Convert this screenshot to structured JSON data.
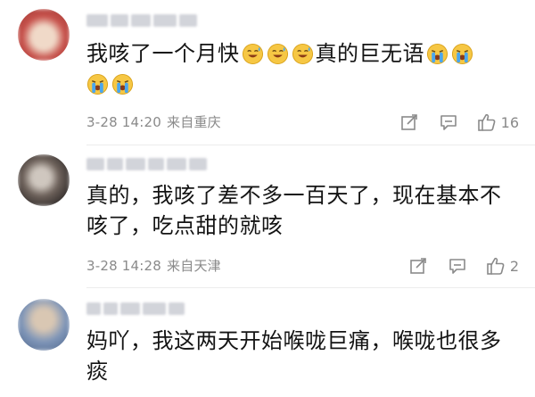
{
  "comments": [
    {
      "text_before": "我咳了一个月快",
      "text_middle": "真的巨无语",
      "date": "3-28 14:20",
      "location": "来自重庆",
      "likes": "16",
      "avatar_colors": [
        "#c7514b",
        "#f0d9c8"
      ]
    },
    {
      "text": "真的，我咳了差不多一百天了，现在基本不咳了，吃点甜的就咳",
      "date": "3-28 14:28",
      "location": "来自天津",
      "likes": "2",
      "avatar_colors": [
        "#3a3432",
        "#cfc7bf"
      ]
    },
    {
      "text": "妈吖，我这两天开始喉咙巨痛，喉咙也很多痰",
      "avatar_colors": [
        "#7e95b8",
        "#d9c7b3"
      ]
    }
  ],
  "icons": {
    "share": "share-icon",
    "reply": "comment-icon",
    "like": "thumbs-up-icon",
    "emoji_smile": "sweat-smile-emoji-icon",
    "emoji_cry": "crying-emoji-icon"
  },
  "colors": {
    "text": "#141414",
    "meta": "#8a8a8a",
    "blurred_username": "#d2d4da",
    "emoji_yellow": "#f6c744",
    "emoji_tear": "#4aa6ef"
  }
}
